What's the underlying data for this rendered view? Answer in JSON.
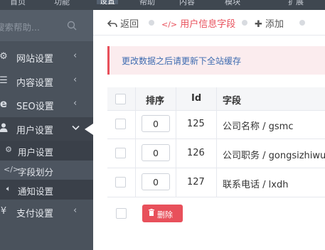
{
  "top_nav": {
    "items": [
      "首页",
      "功能",
      "设置",
      "帮助",
      "内容",
      "模块",
      "扩展"
    ],
    "active_index": 2
  },
  "sidebar": {
    "search_placeholder": "搜索帮助...",
    "menu": [
      {
        "label": "网站设置",
        "icon": "gear-icon"
      },
      {
        "label": "内容设置",
        "icon": "list-icon"
      },
      {
        "label": "SEO设置",
        "icon": "seo-e-icon"
      },
      {
        "label": "用户设置",
        "icon": "user-icon"
      },
      {
        "label": "支付设置",
        "icon": "yen-icon"
      }
    ],
    "submenu": [
      {
        "label": "用户设置",
        "icon": "gear-icon"
      },
      {
        "label": "字段划分",
        "icon": "code-icon"
      },
      {
        "label": "通知设置",
        "icon": "volume-icon"
      }
    ]
  },
  "tabs": {
    "back": "返回",
    "current": "用户信息字段",
    "add": "添加"
  },
  "alert": {
    "message": "更改数据之后请更新下全站缓存"
  },
  "table": {
    "headers": {
      "order": "排序",
      "id": "Id",
      "field": "字段"
    },
    "rows": [
      {
        "order": "0",
        "id": "125",
        "field": "公司名称 / gsmc"
      },
      {
        "order": "0",
        "id": "126",
        "field": "公司职务 / gongsizhiwu"
      },
      {
        "order": "0",
        "id": "127",
        "field": "联系电话 / lxdh"
      }
    ]
  },
  "actions": {
    "delete_label": "删除"
  },
  "colors": {
    "accent": "#e8505b",
    "sidebar_bg": "#4a525c",
    "link": "#3e6bb0"
  }
}
